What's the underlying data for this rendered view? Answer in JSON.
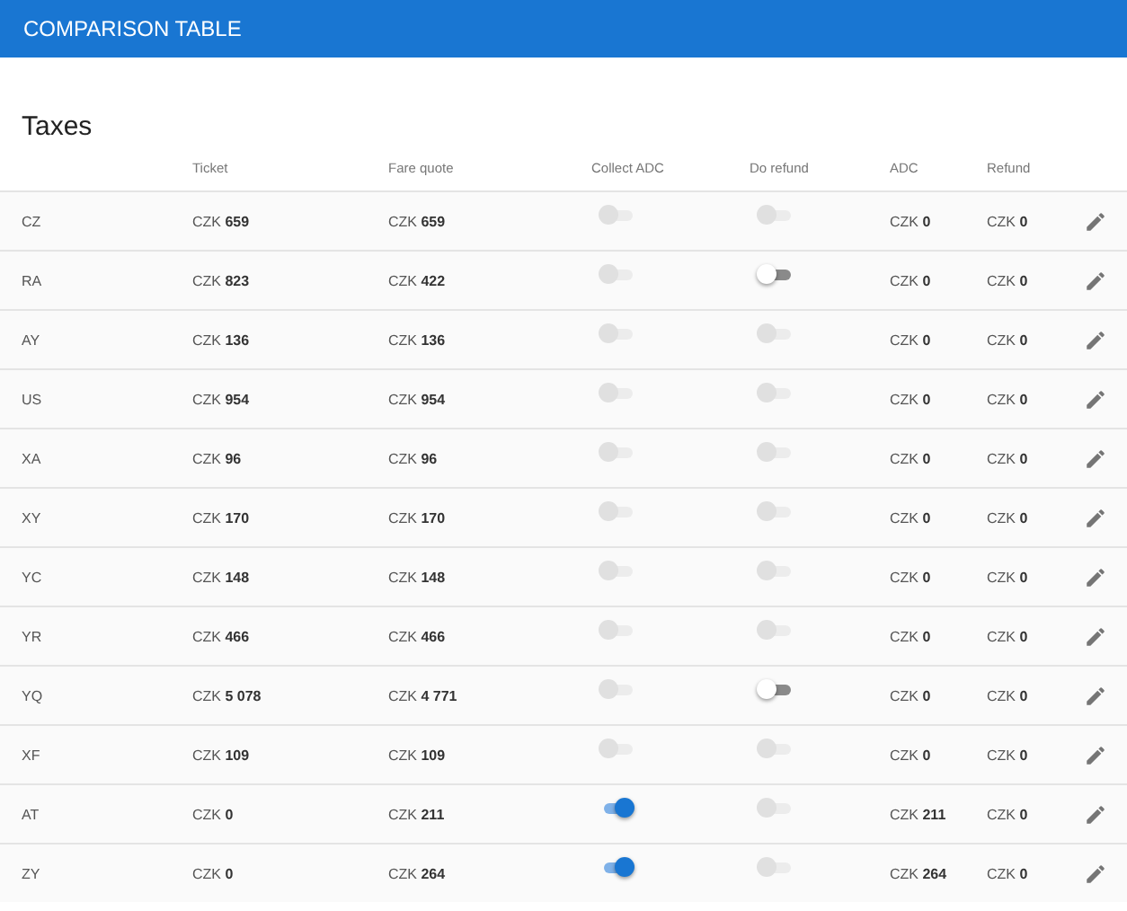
{
  "app_bar": {
    "title": "COMPARISON TABLE"
  },
  "section": {
    "title": "Taxes"
  },
  "table": {
    "columns": [
      "Ticket",
      "Fare quote",
      "Collect ADC",
      "Do refund",
      "ADC",
      "Refund"
    ],
    "rows": [
      {
        "code": "CZ",
        "ticket": "CZK **659**",
        "fare_quote": "CZK **659**",
        "collect_adc": {
          "on": false,
          "disabled": true
        },
        "do_refund": {
          "on": false,
          "disabled": true
        },
        "adc": "CZK **0**",
        "refund": "CZK **0**"
      },
      {
        "code": "RA",
        "ticket": "CZK **823**",
        "fare_quote": "CZK **422**",
        "collect_adc": {
          "on": false,
          "disabled": true
        },
        "do_refund": {
          "on": false,
          "disabled": false
        },
        "adc": "CZK **0**",
        "refund": "CZK **0**"
      },
      {
        "code": "AY",
        "ticket": "CZK **136**",
        "fare_quote": "CZK **136**",
        "collect_adc": {
          "on": false,
          "disabled": true
        },
        "do_refund": {
          "on": false,
          "disabled": true
        },
        "adc": "CZK **0**",
        "refund": "CZK **0**"
      },
      {
        "code": "US",
        "ticket": "CZK **954**",
        "fare_quote": "CZK **954**",
        "collect_adc": {
          "on": false,
          "disabled": true
        },
        "do_refund": {
          "on": false,
          "disabled": true
        },
        "adc": "CZK **0**",
        "refund": "CZK **0**"
      },
      {
        "code": "XA",
        "ticket": "CZK **96**",
        "fare_quote": "CZK **96**",
        "collect_adc": {
          "on": false,
          "disabled": true
        },
        "do_refund": {
          "on": false,
          "disabled": true
        },
        "adc": "CZK **0**",
        "refund": "CZK **0**"
      },
      {
        "code": "XY",
        "ticket": "CZK **170**",
        "fare_quote": "CZK **170**",
        "collect_adc": {
          "on": false,
          "disabled": true
        },
        "do_refund": {
          "on": false,
          "disabled": true
        },
        "adc": "CZK **0**",
        "refund": "CZK **0**"
      },
      {
        "code": "YC",
        "ticket": "CZK **148**",
        "fare_quote": "CZK **148**",
        "collect_adc": {
          "on": false,
          "disabled": true
        },
        "do_refund": {
          "on": false,
          "disabled": true
        },
        "adc": "CZK **0**",
        "refund": "CZK **0**"
      },
      {
        "code": "YR",
        "ticket": "CZK **466**",
        "fare_quote": "CZK **466**",
        "collect_adc": {
          "on": false,
          "disabled": true
        },
        "do_refund": {
          "on": false,
          "disabled": true
        },
        "adc": "CZK **0**",
        "refund": "CZK **0**"
      },
      {
        "code": "YQ",
        "ticket": "CZK **5 078**",
        "fare_quote": "CZK **4 771**",
        "collect_adc": {
          "on": false,
          "disabled": true
        },
        "do_refund": {
          "on": false,
          "disabled": false
        },
        "adc": "CZK **0**",
        "refund": "CZK **0**"
      },
      {
        "code": "XF",
        "ticket": "CZK **109**",
        "fare_quote": "CZK **109**",
        "collect_adc": {
          "on": false,
          "disabled": true
        },
        "do_refund": {
          "on": false,
          "disabled": true
        },
        "adc": "CZK **0**",
        "refund": "CZK **0**"
      },
      {
        "code": "AT",
        "ticket": "CZK **0**",
        "fare_quote": "CZK **211**",
        "collect_adc": {
          "on": true,
          "disabled": false
        },
        "do_refund": {
          "on": false,
          "disabled": true
        },
        "adc": "CZK **211**",
        "refund": "CZK **0**"
      },
      {
        "code": "ZY",
        "ticket": "CZK **0**",
        "fare_quote": "CZK **264**",
        "collect_adc": {
          "on": true,
          "disabled": false
        },
        "do_refund": {
          "on": false,
          "disabled": true
        },
        "adc": "CZK **264**",
        "refund": "CZK **0**"
      }
    ]
  }
}
